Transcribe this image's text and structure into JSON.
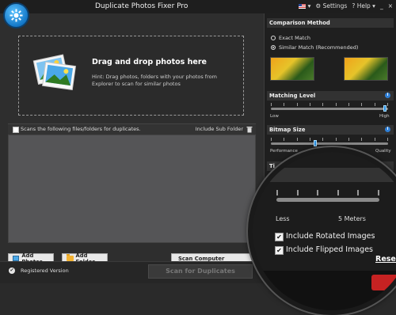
{
  "titlebar": {
    "app_title": "Duplicate Photos Fixer Pro",
    "settings_label": "Settings",
    "help_label": "? Help",
    "minimize": "_",
    "close": "×"
  },
  "drop": {
    "title": "Drag and drop photos here",
    "hint": "Hint: Drag photos, folders with your photos from Explorer to scan for similar photos"
  },
  "scan_options": {
    "scan_label": "Scans the following files/folders for duplicates.",
    "subfolder_label": "Include Sub Folder"
  },
  "buttons": {
    "add_photos": "Add Photos",
    "add_folder": "Add Folder",
    "scan_computer": "Scan Computer",
    "scan_duplicates": "Scan for Duplicates"
  },
  "status": {
    "registered": "Registered Version"
  },
  "right_panel": {
    "comparison_method": "Comparison Method",
    "exact_match": "Exact Match",
    "similar_match": "Similar Match (Recommended)",
    "matching_level": "Matching Level",
    "low": "Low",
    "high": "High",
    "bitmap_size": "Bitmap Size",
    "performance": "Performance",
    "quality": "Quality",
    "time_cut": "Ti"
  },
  "magnifier": {
    "less": "Less",
    "meters": "5 Meters",
    "rotated": "Include Rotated Images",
    "flipped": "Include Flipped Images",
    "reset": "Reset"
  },
  "controls": {
    "selected_method": "similar_match",
    "matching_level_fraction": 0.97,
    "bitmap_size_fraction": 0.38
  },
  "colors": {
    "accent": "#2d8fe0",
    "info": "#2f7fd6"
  }
}
